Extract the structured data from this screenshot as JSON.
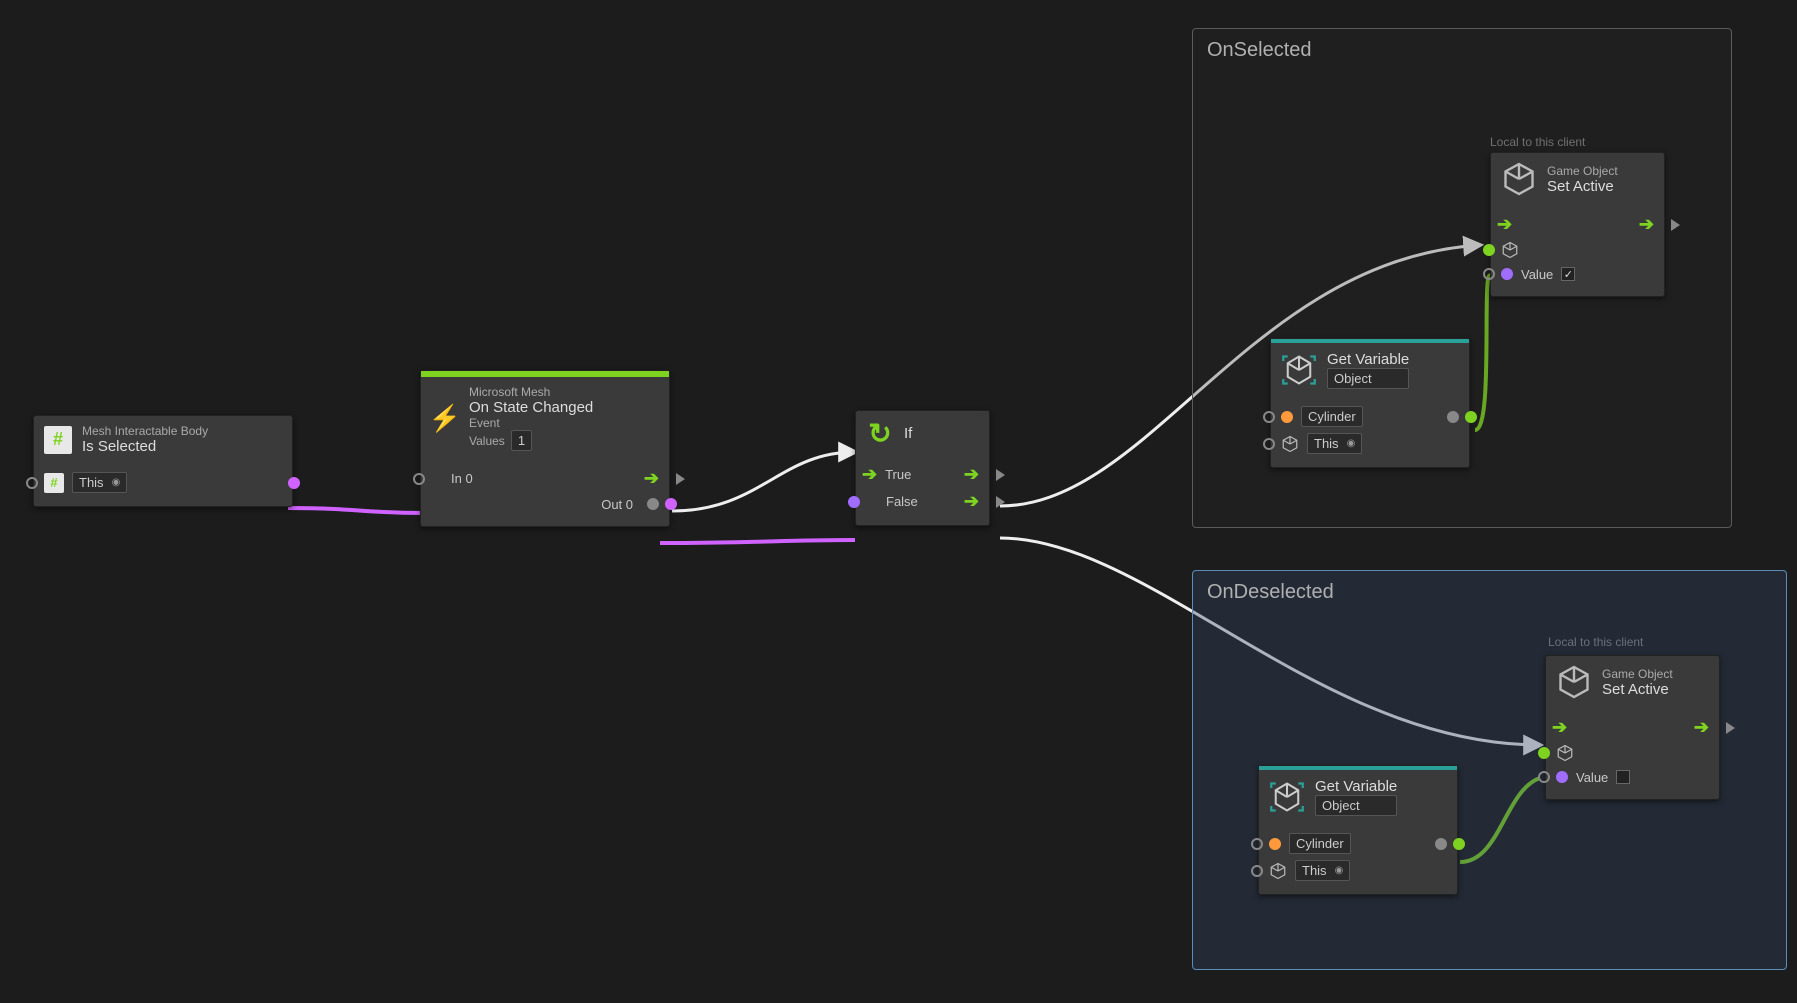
{
  "groups": {
    "onSelected": {
      "title": "OnSelected",
      "local_label": "Local to this client"
    },
    "onDeselected": {
      "title": "OnDeselected",
      "local_label": "Local to this client"
    }
  },
  "nodes": {
    "isSelected": {
      "subtitle": "Mesh Interactable Body",
      "title": "Is Selected",
      "target_field": "This"
    },
    "onStateChanged": {
      "subtitle": "Microsoft Mesh",
      "title": "On State Changed",
      "meta1": "Event",
      "meta2_label": "Values",
      "meta2_value": "1",
      "in_label": "In 0",
      "out_label": "Out 0"
    },
    "ifNode": {
      "title": "If",
      "true_label": "True",
      "false_label": "False"
    },
    "getVar1": {
      "title": "Get Variable",
      "scope": "Object",
      "var_name": "Cylinder",
      "target": "This"
    },
    "getVar2": {
      "title": "Get Variable",
      "scope": "Object",
      "var_name": "Cylinder",
      "target": "This"
    },
    "setActive1": {
      "subtitle": "Game Object",
      "title": "Set Active",
      "value_label": "Value",
      "value_checked": true
    },
    "setActive2": {
      "subtitle": "Game Object",
      "title": "Set Active",
      "value_label": "Value",
      "value_checked": false
    }
  }
}
